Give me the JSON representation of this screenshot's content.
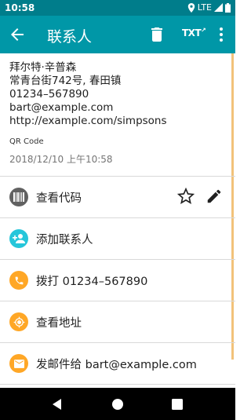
{
  "status_bar": {
    "time": "10:58",
    "network": "LTE"
  },
  "app_bar": {
    "title": "联系人",
    "txt_label": "TXT"
  },
  "contact": {
    "lines": [
      "拜尔特·辛普森",
      "常青台街742号, 春田镇",
      "01234–567890",
      "bart@example.com",
      "http://example.com/simpsons"
    ],
    "format": "QR Code",
    "timestamp": "2018/12/10 上午10:58"
  },
  "actions": [
    {
      "label": "查看代码",
      "icon": "barcode-icon",
      "color": "#616161"
    },
    {
      "label": "添加联系人",
      "icon": "add-person-icon",
      "color": "#26c6da"
    },
    {
      "label": "拨打 01234–567890",
      "icon": "phone-icon",
      "color": "#ffa726"
    },
    {
      "label": "查看地址",
      "icon": "location-icon",
      "color": "#ffa726"
    },
    {
      "label": "发邮件给 bart@example.com",
      "icon": "email-icon",
      "color": "#ffa726"
    }
  ],
  "colors": {
    "status_bar": "#007d8b",
    "app_bar": "#0097a7",
    "accent": "#ffa726"
  }
}
